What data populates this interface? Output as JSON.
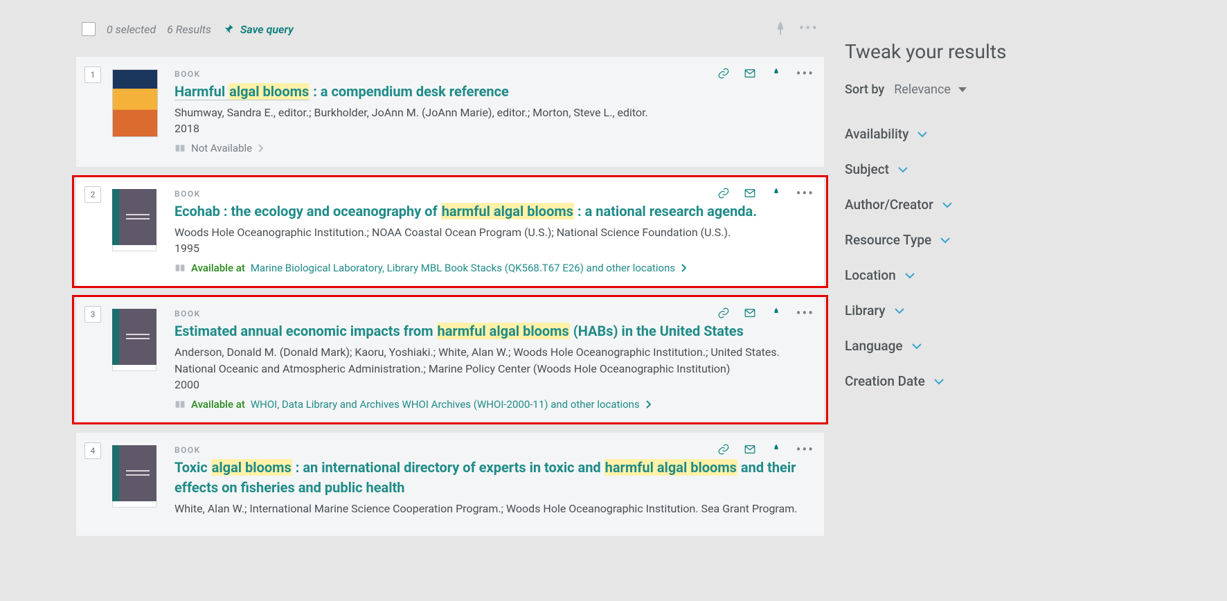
{
  "header": {
    "selected_text": "0 selected",
    "results_text": "6 Results",
    "save_query": "Save query"
  },
  "sidebar": {
    "tweak_title": "Tweak your results",
    "sort_label": "Sort by",
    "sort_value": "Relevance",
    "filters": [
      "Availability",
      "Subject",
      "Author/Creator",
      "Resource Type",
      "Location",
      "Library",
      "Language",
      "Creation Date"
    ]
  },
  "results": [
    {
      "num": "1",
      "type": "BOOK",
      "title_parts": [
        {
          "t": "Harmful ",
          "hl": false,
          "u": true
        },
        {
          "t": "algal blooms",
          "hl": true,
          "u": true
        },
        {
          "t": " : a compendium desk reference",
          "hl": false,
          "u": false
        }
      ],
      "authors": "Shumway, Sandra E., editor.; Burkholder, JoAnn M. (JoAnn Marie), editor.; Morton, Steve L., editor.",
      "year": "2018",
      "availability": {
        "status": "unavailable",
        "status_text": "Not Available"
      },
      "thumb": "image",
      "white": false
    },
    {
      "num": "2",
      "type": "BOOK",
      "title_parts": [
        {
          "t": "Ecohab : the ecology and oceanography of ",
          "hl": false,
          "u": false
        },
        {
          "t": "harmful algal blooms",
          "hl": true,
          "u": false
        },
        {
          "t": " : a national research agenda.",
          "hl": false,
          "u": false
        }
      ],
      "authors": "Woods Hole Oceanographic Institution.; NOAA Coastal Ocean Program (U.S.); National Science Foundation (U.S.).",
      "year": "1995",
      "availability": {
        "status": "available",
        "status_text": "Available at",
        "location": "Marine Biological Laboratory, Library  MBL Book Stacks (QK568.T67 E26) and other locations"
      },
      "thumb": "generic",
      "white": true,
      "highlight": true
    },
    {
      "num": "3",
      "type": "BOOK",
      "title_parts": [
        {
          "t": "Estimated annual economic impacts from ",
          "hl": false,
          "u": false
        },
        {
          "t": "harmful algal blooms",
          "hl": true,
          "u": false
        },
        {
          "t": " (HABs) in the United States",
          "hl": false,
          "u": false
        }
      ],
      "authors": "Anderson, Donald M. (Donald Mark); Kaoru, Yoshiaki.; White, Alan W.; Woods Hole Oceanographic Institution.; United States. National Oceanic and Atmospheric Administration.; Marine Policy Center (Woods Hole Oceanographic Institution)",
      "year": "2000",
      "availability": {
        "status": "available",
        "status_text": "Available at",
        "location": "WHOI, Data Library and Archives  WHOI Archives (WHOI-2000-11) and other locations"
      },
      "thumb": "generic",
      "white": false,
      "highlight": true
    },
    {
      "num": "4",
      "type": "BOOK",
      "title_parts": [
        {
          "t": "Toxic ",
          "hl": false,
          "u": false
        },
        {
          "t": "algal blooms",
          "hl": true,
          "u": false
        },
        {
          "t": " : an international directory of experts in toxic and ",
          "hl": false,
          "u": false
        },
        {
          "t": "harmful algal blooms",
          "hl": true,
          "u": false
        },
        {
          "t": " and their effects on fisheries and public health",
          "hl": false,
          "u": false
        }
      ],
      "authors": "White, Alan W.; International Marine Science Cooperation Program.; Woods Hole Oceanographic Institution. Sea Grant Program.",
      "year": "",
      "availability": null,
      "thumb": "generic",
      "white": false
    }
  ]
}
